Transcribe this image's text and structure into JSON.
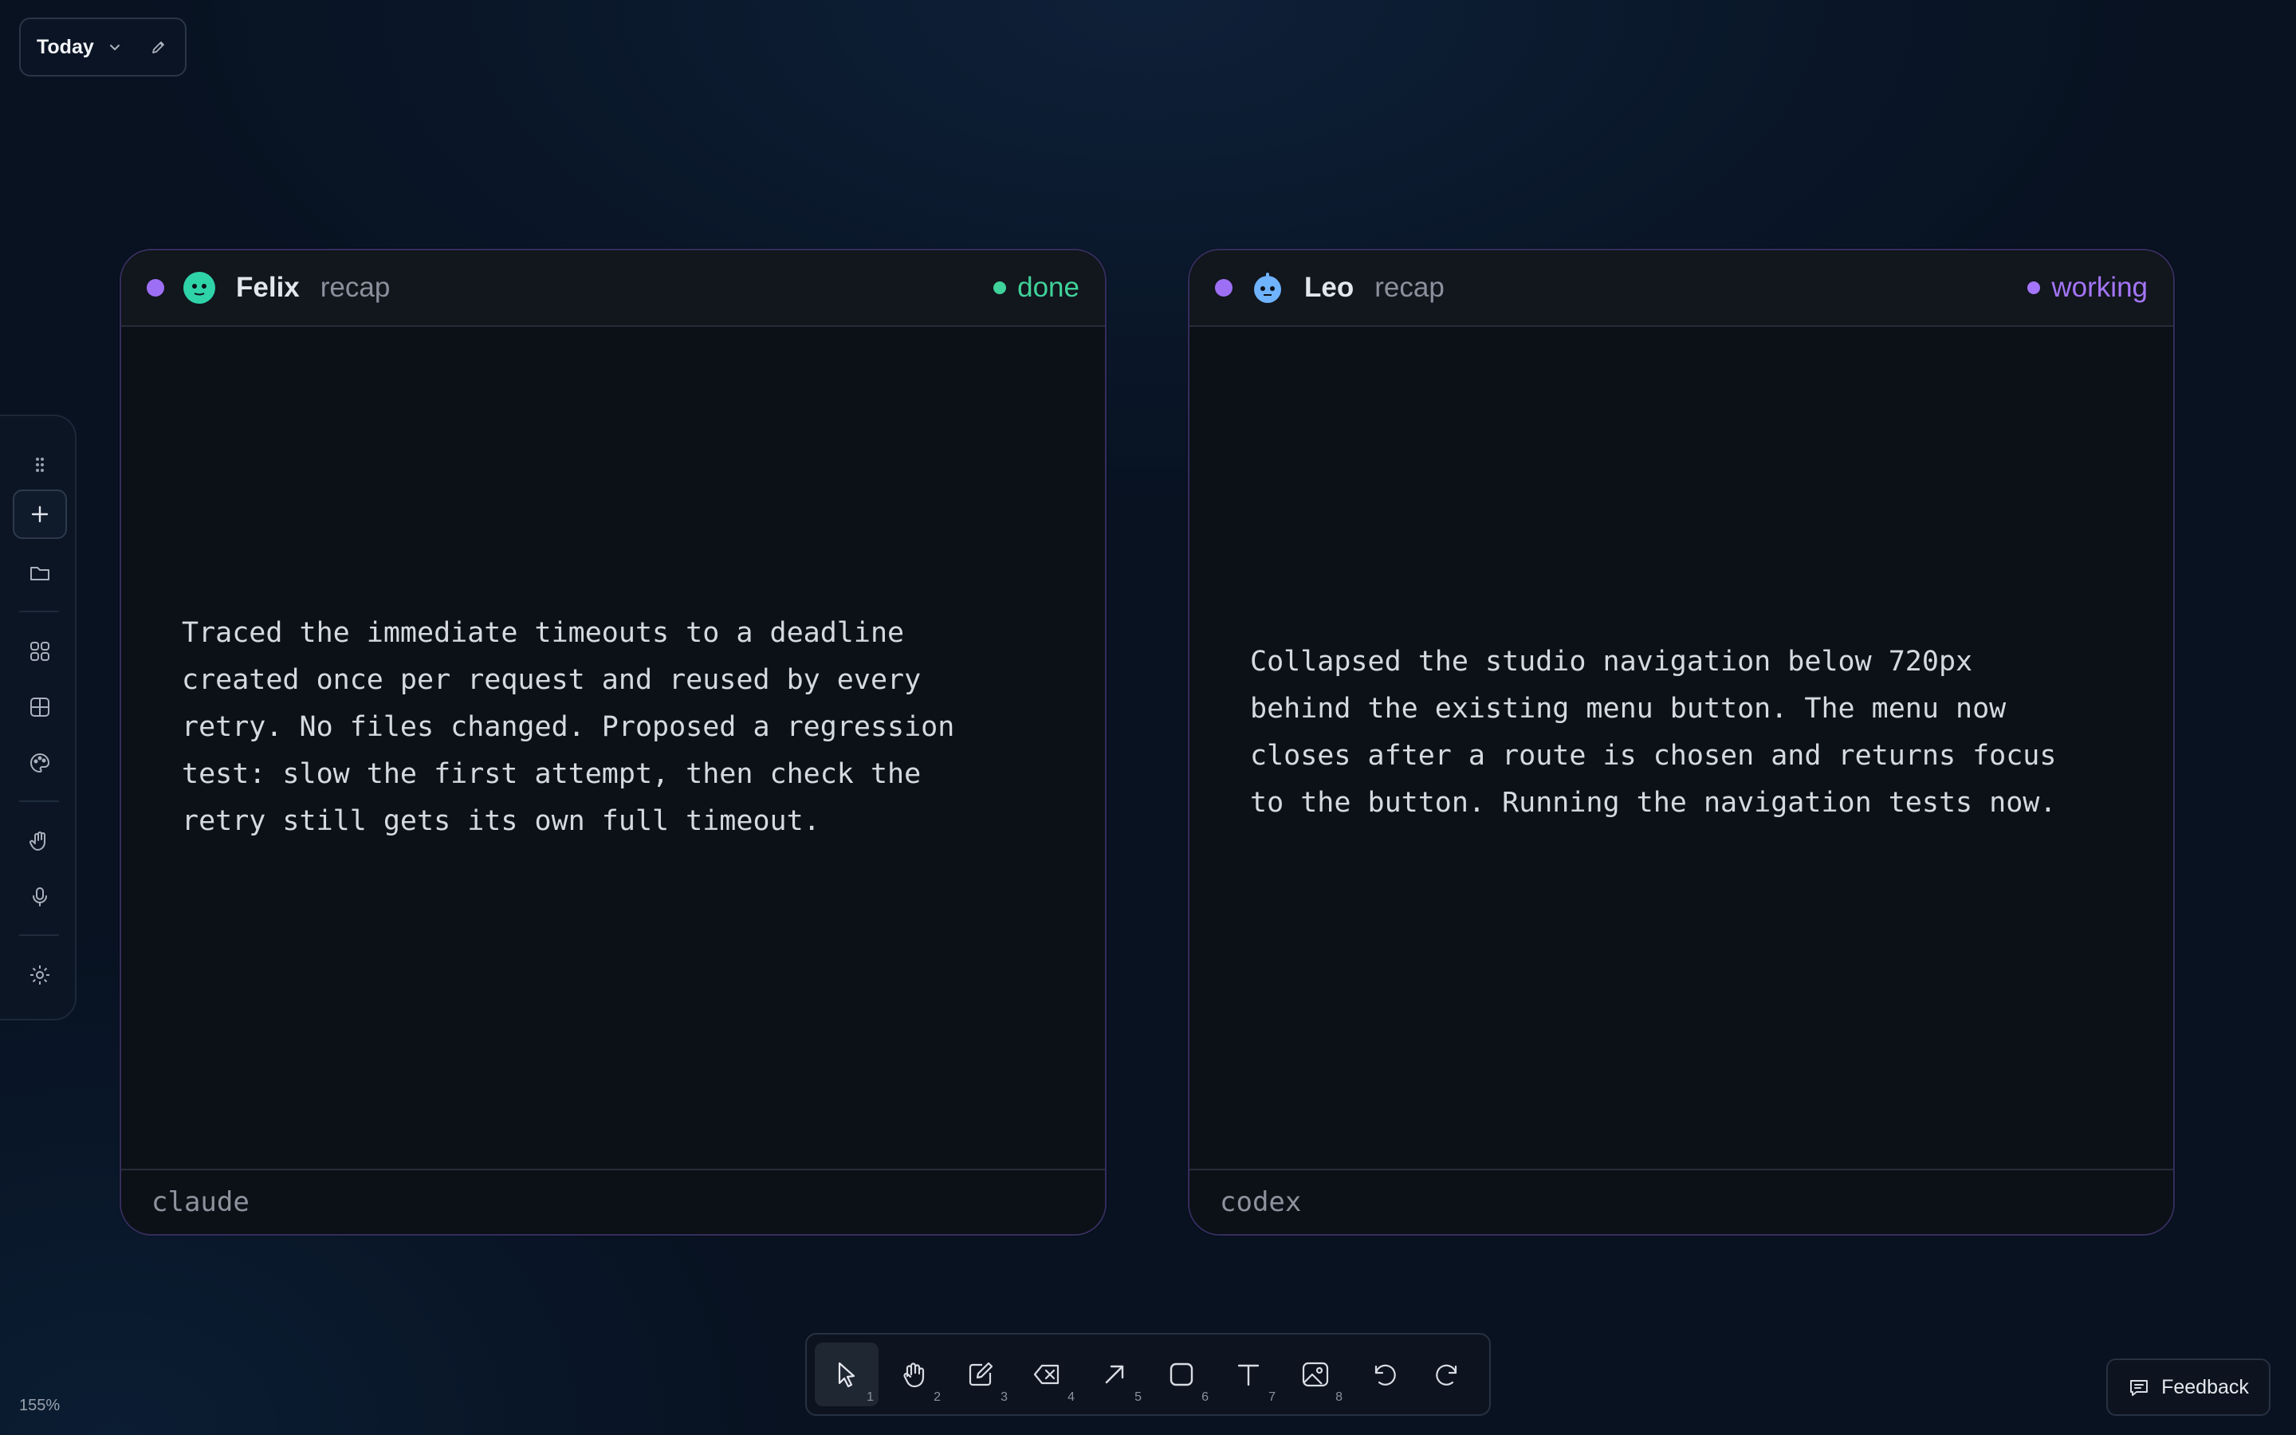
{
  "header": {
    "date_label": "Today",
    "icons": [
      "chevron-down-icon",
      "pencil-icon"
    ]
  },
  "sidebar": {
    "items": [
      {
        "icon": "drag-handle-icon"
      },
      {
        "icon": "plus-icon"
      },
      {
        "icon": "folder-icon"
      },
      {
        "icon": "apps-icon"
      },
      {
        "icon": "grid-icon"
      },
      {
        "icon": "palette-icon"
      },
      {
        "icon": "hand-icon"
      },
      {
        "icon": "microphone-icon"
      },
      {
        "icon": "settings-icon"
      }
    ]
  },
  "cards": [
    {
      "name": "Felix",
      "tag": "recap",
      "status": "done",
      "status_color": "#3fd29a",
      "avatar_color": "#2fd3a8",
      "body": "Traced the immediate timeouts to a deadline\ncreated once per request and reused by every\nretry. No files changed. Proposed a regression\ntest: slow the first attempt, then check the\nretry still gets its own full timeout.",
      "footer": "claude"
    },
    {
      "name": "Leo",
      "tag": "recap",
      "status": "working",
      "status_color": "#a475f8",
      "avatar_color": "#6fb3ff",
      "body": "Collapsed the studio navigation below 720px\nbehind the existing menu button. The menu now\ncloses after a route is chosen and returns focus\nto the button. Running the navigation tests now.",
      "footer": "codex"
    }
  ],
  "toolbar": {
    "tools": [
      {
        "icon": "pointer-icon",
        "key": "1",
        "active": true
      },
      {
        "icon": "hand-icon",
        "key": "2"
      },
      {
        "icon": "pencil-icon",
        "key": "3"
      },
      {
        "icon": "eraser-icon",
        "key": "4"
      },
      {
        "icon": "arrow-icon",
        "key": "5"
      },
      {
        "icon": "rectangle-icon",
        "key": "6"
      },
      {
        "icon": "text-icon",
        "key": "7"
      },
      {
        "icon": "image-icon",
        "key": "8"
      },
      {
        "icon": "undo-icon",
        "key": ""
      },
      {
        "icon": "redo-icon",
        "key": ""
      }
    ]
  },
  "zoom_label": "155%",
  "feedback_label": "Feedback",
  "colors": {
    "background": "#081221",
    "card_border": "#352e5e",
    "agent_dot": "#9d6ff5"
  }
}
